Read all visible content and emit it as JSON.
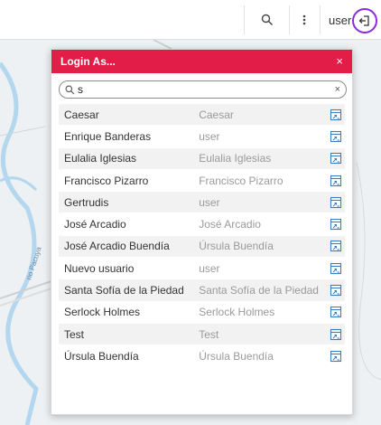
{
  "topbar": {
    "user_label": "user",
    "icons": [
      "search-icon",
      "more-vert-icon",
      "logout-icon"
    ]
  },
  "dialog": {
    "title": "Login As...",
    "close_glyph": "×",
    "search": {
      "value": "s",
      "clear_glyph": "×"
    },
    "rows": [
      {
        "name": "Caesar",
        "user": "Caesar"
      },
      {
        "name": "Enrique Banderas",
        "user": "user"
      },
      {
        "name": "Eulalia Iglesias",
        "user": "Eulalia Iglesias"
      },
      {
        "name": "Francisco Pizarro",
        "user": "Francisco Pizarro"
      },
      {
        "name": "Gertrudis",
        "user": "user"
      },
      {
        "name": "José Arcadio",
        "user": "José Arcadio"
      },
      {
        "name": "José Arcadio Buendía",
        "user": "Úrsula Buendía"
      },
      {
        "name": "Nuevo usuario",
        "user": "user"
      },
      {
        "name": "Santa Sofía de la Piedad",
        "user": "Santa Sofía de la Piedad"
      },
      {
        "name": "Serlock Holmes",
        "user": "Serlock Holmes"
      },
      {
        "name": "Test",
        "user": "Test"
      },
      {
        "name": "Úrsula Buendía",
        "user": "Úrsula Buendía"
      }
    ]
  },
  "map": {
    "road_label": "rio Pacuya"
  },
  "colors": {
    "header": "#e21d48",
    "accent_ring": "#8a2be2",
    "river": "#b3d7ef",
    "icon_blue": "#3a7fc4"
  }
}
